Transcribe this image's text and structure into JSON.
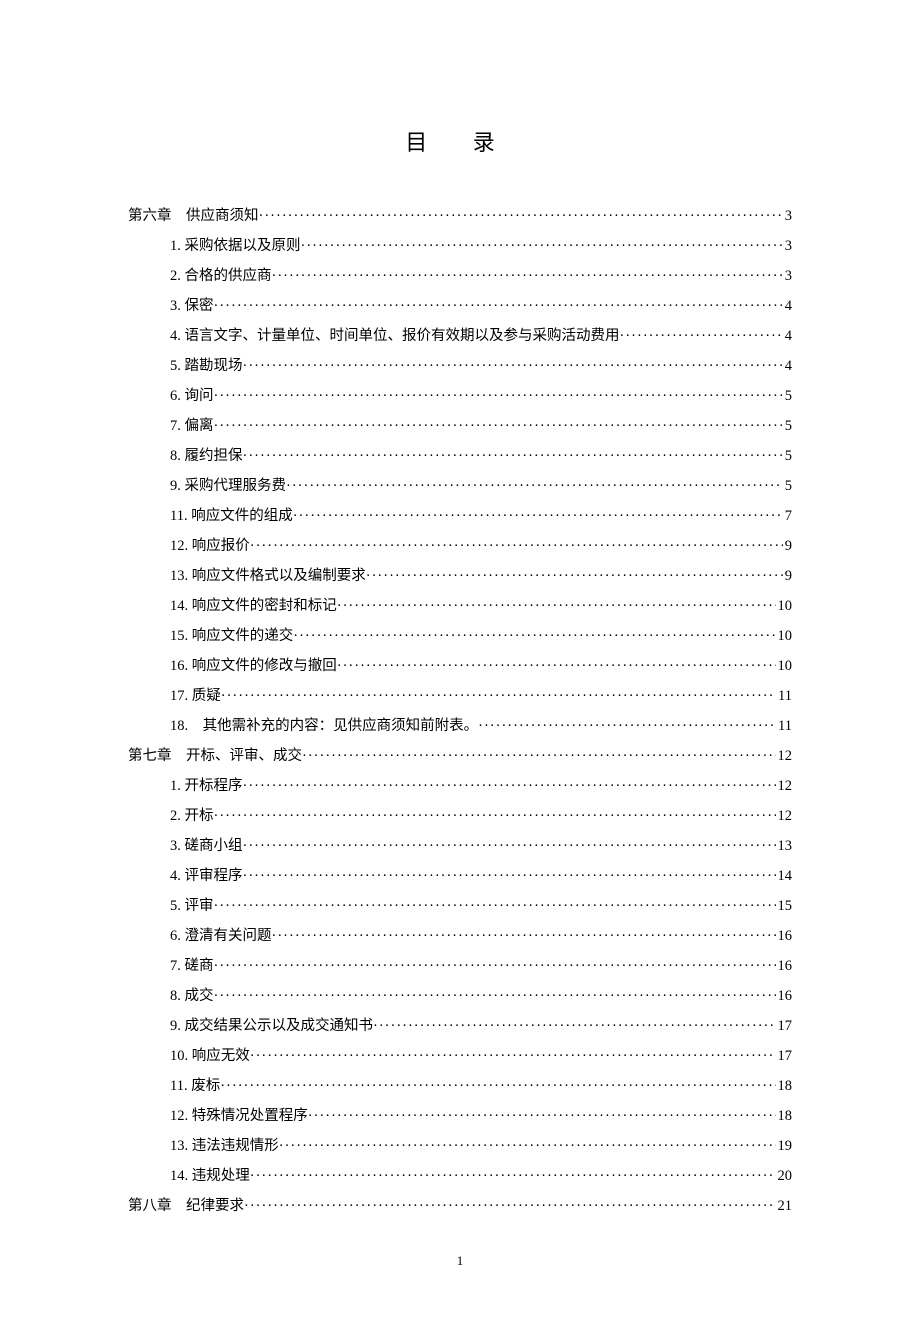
{
  "title": "目 录",
  "page_number": "1",
  "toc": [
    {
      "indent": 0,
      "label": "第六章　供应商须知",
      "page": "3"
    },
    {
      "indent": 1,
      "label": "1. 采购依据以及原则",
      "page": "3"
    },
    {
      "indent": 1,
      "label": "2. 合格的供应商",
      "page": "3"
    },
    {
      "indent": 1,
      "label": "3. 保密",
      "page": "4"
    },
    {
      "indent": 1,
      "label": "4. 语言文字、计量单位、时间单位、报价有效期以及参与采购活动费用",
      "page": "4"
    },
    {
      "indent": 1,
      "label": "5. 踏勘现场",
      "page": "4"
    },
    {
      "indent": 1,
      "label": "6. 询问",
      "page": "5"
    },
    {
      "indent": 1,
      "label": "7. 偏离",
      "page": "5"
    },
    {
      "indent": 1,
      "label": "8. 履约担保",
      "page": "5"
    },
    {
      "indent": 1,
      "label": "9. 采购代理服务费",
      "page": "5"
    },
    {
      "indent": 1,
      "label": "11. 响应文件的组成",
      "page": "7"
    },
    {
      "indent": 1,
      "label": "12. 响应报价",
      "page": "9"
    },
    {
      "indent": 1,
      "label": "13. 响应文件格式以及编制要求",
      "page": "9"
    },
    {
      "indent": 1,
      "label": "14. 响应文件的密封和标记",
      "page": "10"
    },
    {
      "indent": 1,
      "label": "15. 响应文件的递交",
      "page": "10"
    },
    {
      "indent": 1,
      "label": "16. 响应文件的修改与撤回",
      "page": "10"
    },
    {
      "indent": 1,
      "label": "17. 质疑",
      "page": "11"
    },
    {
      "indent": 1,
      "label": "18.　其他需补充的内容：见供应商须知前附表。",
      "page": "11"
    },
    {
      "indent": 0,
      "label": "第七章　开标、评审、成交",
      "page": "12"
    },
    {
      "indent": 1,
      "label": "1. 开标程序",
      "page": "12"
    },
    {
      "indent": 1,
      "label": "2. 开标",
      "page": "12"
    },
    {
      "indent": 1,
      "label": "3. 磋商小组",
      "page": "13"
    },
    {
      "indent": 1,
      "label": "4. 评审程序",
      "page": "14"
    },
    {
      "indent": 1,
      "label": "5. 评审",
      "page": "15"
    },
    {
      "indent": 1,
      "label": "6. 澄清有关问题",
      "page": "16"
    },
    {
      "indent": 1,
      "label": "7. 磋商",
      "page": "16"
    },
    {
      "indent": 1,
      "label": "8. 成交",
      "page": "16"
    },
    {
      "indent": 1,
      "label": "9. 成交结果公示以及成交通知书",
      "page": "17"
    },
    {
      "indent": 1,
      "label": "10. 响应无效",
      "page": "17"
    },
    {
      "indent": 1,
      "label": "11. 废标",
      "page": "18"
    },
    {
      "indent": 1,
      "label": "12. 特殊情况处置程序",
      "page": "18"
    },
    {
      "indent": 1,
      "label": "13. 违法违规情形",
      "page": "19"
    },
    {
      "indent": 1,
      "label": "14. 违规处理",
      "page": "20"
    },
    {
      "indent": 0,
      "label": "第八章　纪律要求",
      "page": "21"
    }
  ]
}
